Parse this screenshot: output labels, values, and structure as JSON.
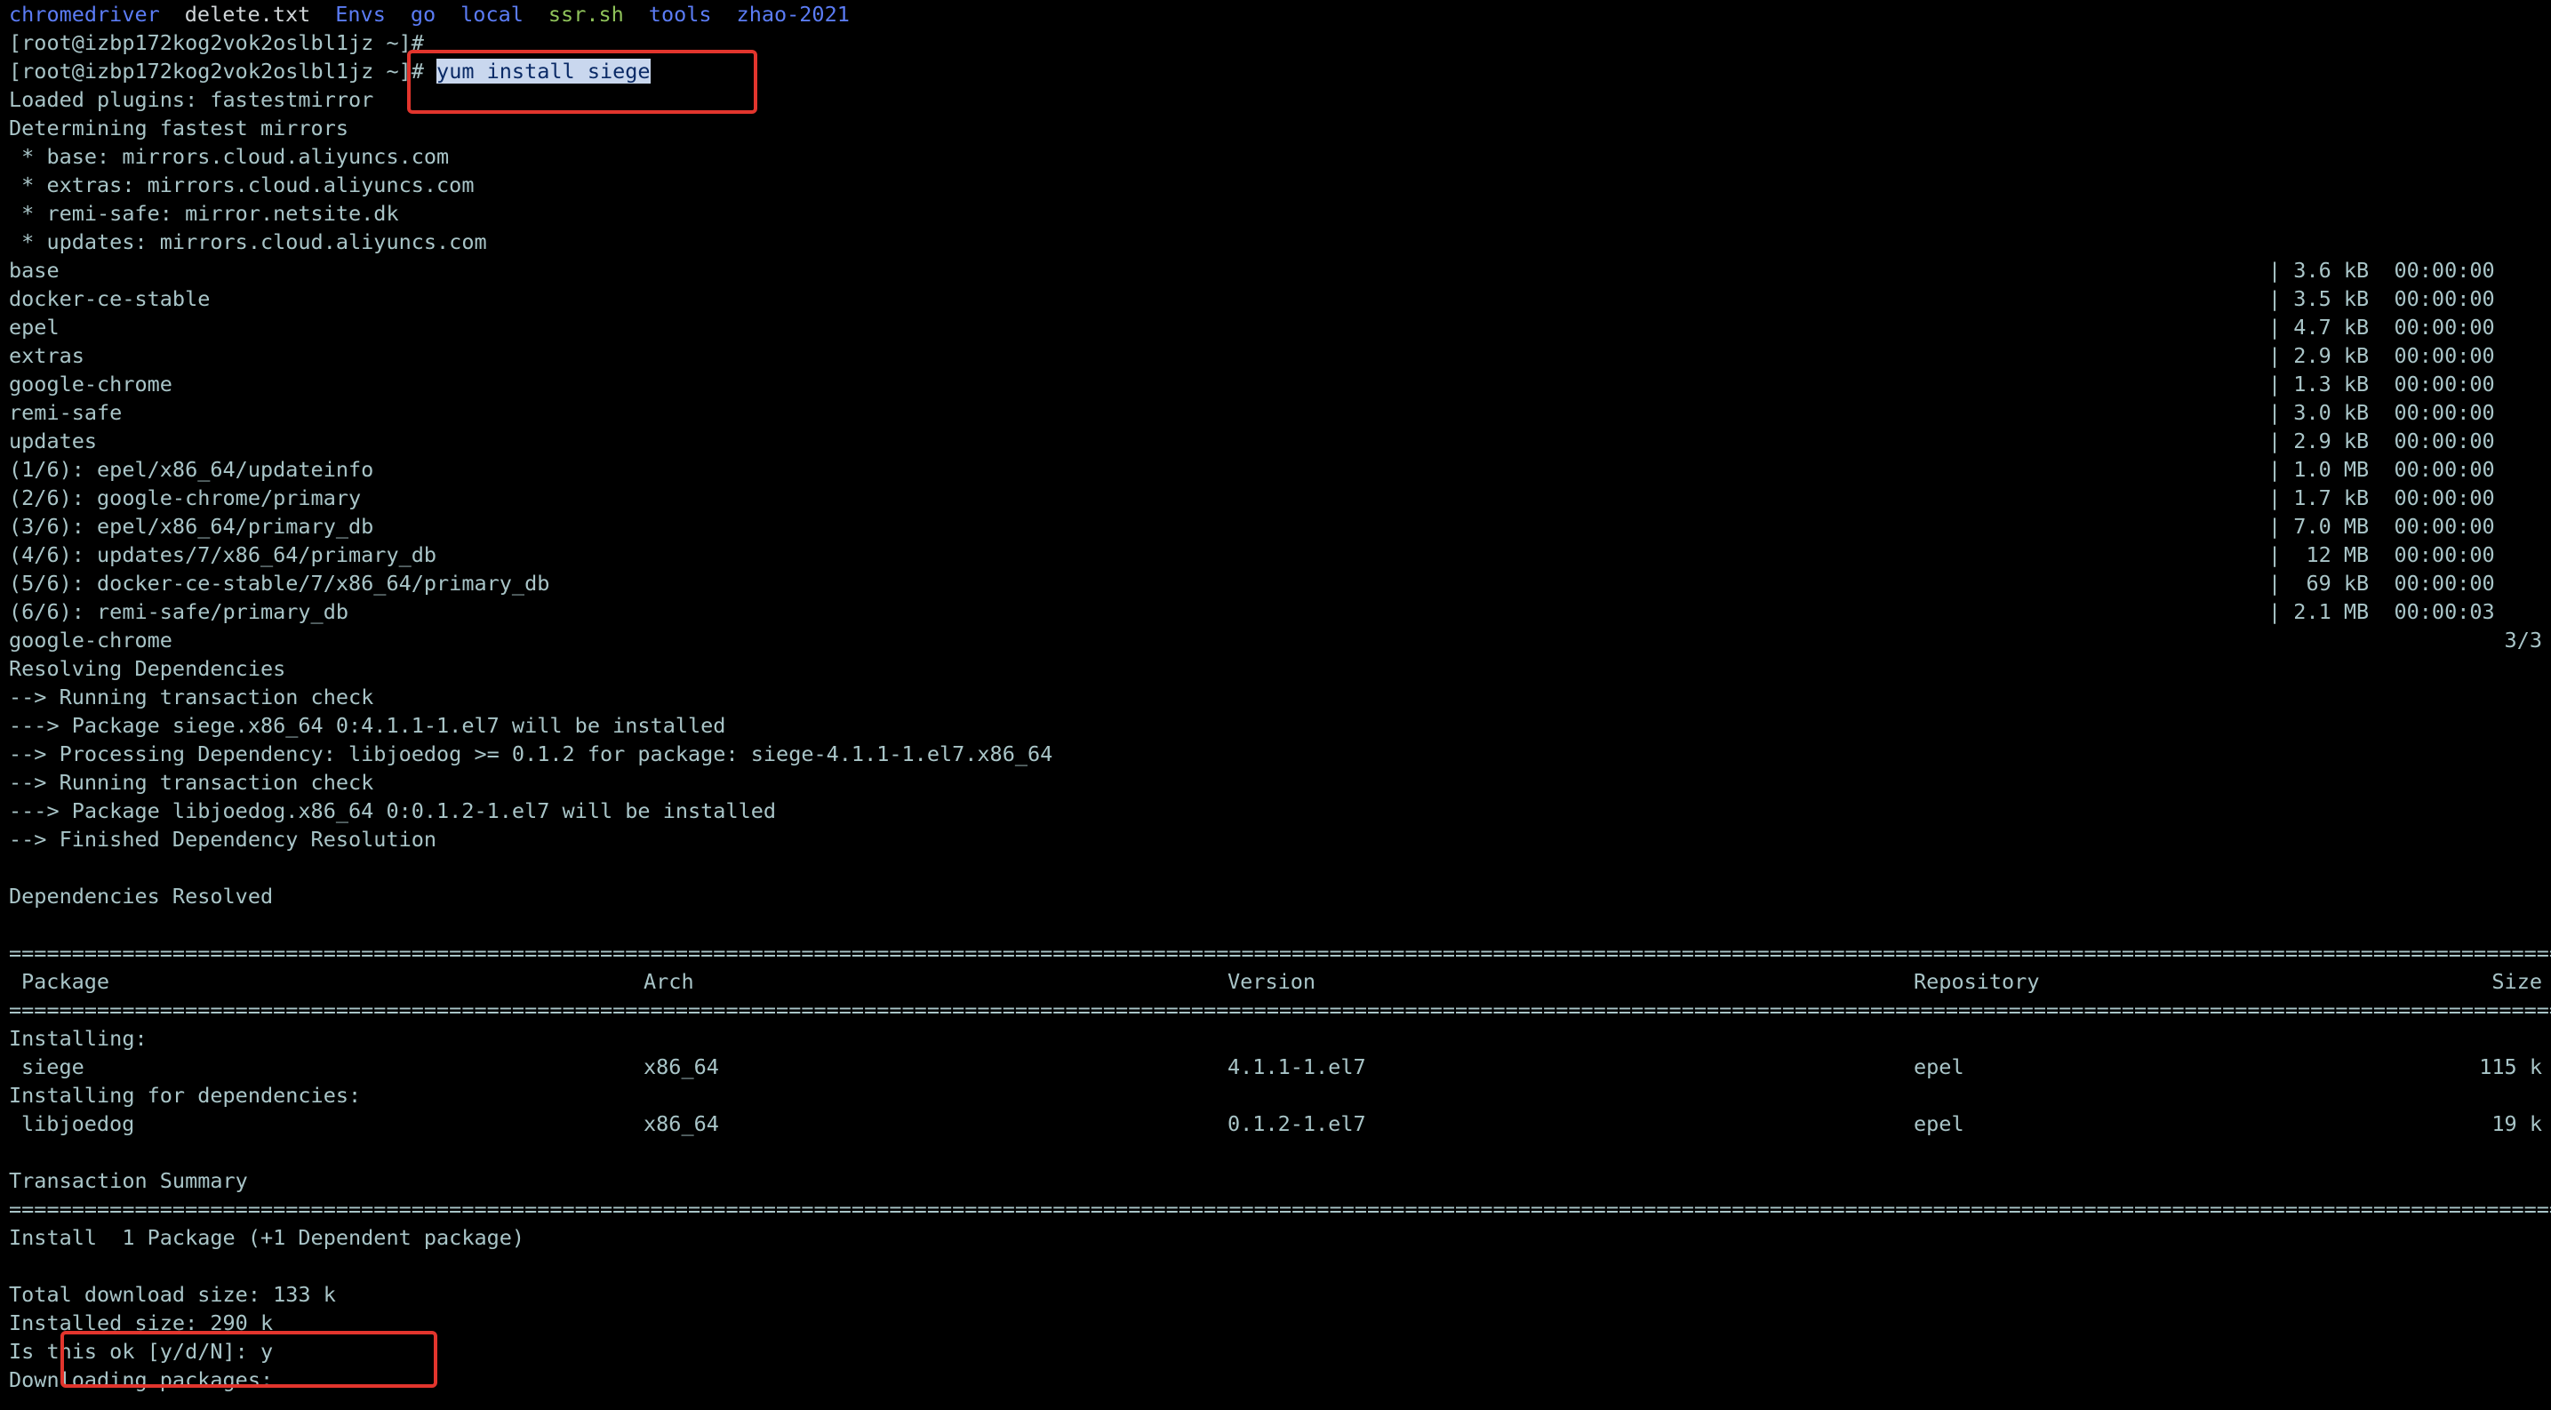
{
  "ls_items": [
    {
      "text": "chromedriver",
      "color": "#5b7cf5"
    },
    {
      "text": "delete.txt",
      "color": "#d0d5d8"
    },
    {
      "text": "Envs",
      "color": "#5b7cf5"
    },
    {
      "text": "go",
      "color": "#5b7cf5"
    },
    {
      "text": "local",
      "color": "#5b7cf5"
    },
    {
      "text": "ssr.sh",
      "color": "#8fc35a"
    },
    {
      "text": "tools",
      "color": "#5b7cf5"
    },
    {
      "text": "zhao-2021",
      "color": "#5b7cf5"
    }
  ],
  "prompt": "[root@izbp172kog2vok2oslbl1jz ~]# ",
  "command": "yum install siege",
  "plugins_lines": [
    "Loaded plugins: fastestmirror",
    "Determining fastest mirrors",
    " * base: mirrors.cloud.aliyuncs.com",
    " * extras: mirrors.cloud.aliyuncs.com",
    " * remi-safe: mirror.netsite.dk",
    " * updates: mirrors.cloud.aliyuncs.com"
  ],
  "repo_rows": [
    {
      "name": "base",
      "info": "| 3.6 kB  00:00:00"
    },
    {
      "name": "docker-ce-stable",
      "info": "| 3.5 kB  00:00:00"
    },
    {
      "name": "epel",
      "info": "| 4.7 kB  00:00:00"
    },
    {
      "name": "extras",
      "info": "| 2.9 kB  00:00:00"
    },
    {
      "name": "google-chrome",
      "info": "| 1.3 kB  00:00:00"
    },
    {
      "name": "remi-safe",
      "info": "| 3.0 kB  00:00:00"
    },
    {
      "name": "updates",
      "info": "| 2.9 kB  00:00:00"
    },
    {
      "name": "(1/6): epel/x86_64/updateinfo",
      "info": "| 1.0 MB  00:00:00"
    },
    {
      "name": "(2/6): google-chrome/primary",
      "info": "| 1.7 kB  00:00:00"
    },
    {
      "name": "(3/6): epel/x86_64/primary_db",
      "info": "| 7.0 MB  00:00:00"
    },
    {
      "name": "(4/6): updates/7/x86_64/primary_db",
      "info": "|  12 MB  00:00:00"
    },
    {
      "name": "(5/6): docker-ce-stable/7/x86_64/primary_db",
      "info": "|  69 kB  00:00:00"
    },
    {
      "name": "(6/6): remi-safe/primary_db",
      "info": "| 2.1 MB  00:00:03"
    }
  ],
  "chrome_line": {
    "name": "google-chrome",
    "count": "3/3"
  },
  "resolve_lines": [
    "Resolving Dependencies",
    "--> Running transaction check",
    "---> Package siege.x86_64 0:4.1.1-1.el7 will be installed",
    "--> Processing Dependency: libjoedog >= 0.1.2 for package: siege-4.1.1-1.el7.x86_64",
    "--> Running transaction check",
    "---> Package libjoedog.x86_64 0:0.1.2-1.el7 will be installed",
    "--> Finished Dependency Resolution",
    "",
    "Dependencies Resolved",
    ""
  ],
  "table": {
    "headers": [
      "Package",
      "Arch",
      "Version",
      "Repository",
      "Size"
    ],
    "installing_label": "Installing:",
    "main_row": [
      "siege",
      "x86_64",
      "4.1.1-1.el7",
      "epel",
      "115 k"
    ],
    "deps_label": "Installing for dependencies:",
    "dep_row": [
      "libjoedog",
      "x86_64",
      "0.1.2-1.el7",
      "epel",
      "19 k"
    ]
  },
  "summary_title": "Transaction Summary",
  "summary_lines": [
    "Install  1 Package (+1 Dependent package)",
    "",
    "Total download size: 133 k",
    "Installed size: 290 k",
    "Is this ok [y/d/N]: y",
    "Downloading packages:"
  ],
  "highlight_color": "#e2352d"
}
